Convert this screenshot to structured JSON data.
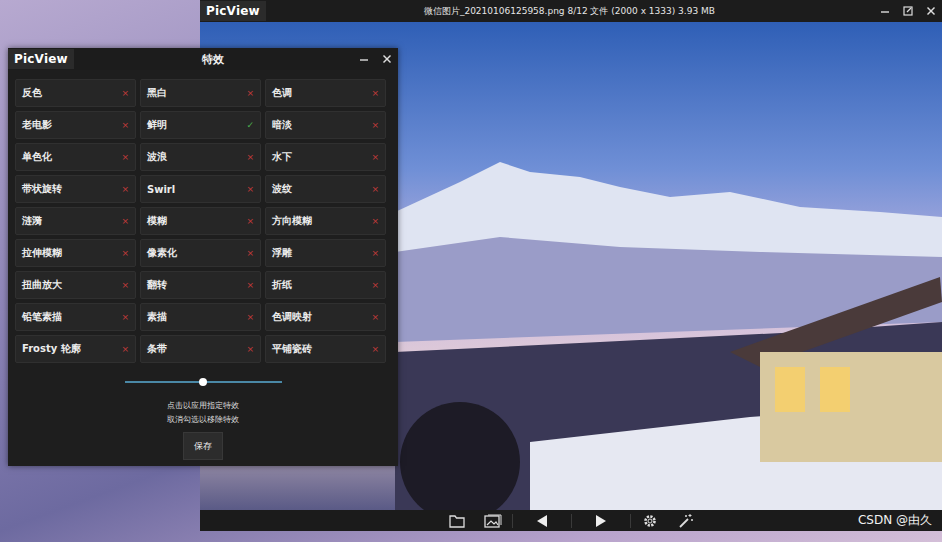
{
  "main_window": {
    "logo": "PicView",
    "title": "微信图片_20210106125958.png 8/12 文件 (2000 x 1333) 3.93 MB",
    "watermark": "CSDN @由久"
  },
  "effects_window": {
    "logo": "PicView",
    "title": "特效"
  },
  "effects": [
    {
      "label": "反色",
      "applied": false,
      "mark": "×"
    },
    {
      "label": "黑白",
      "applied": false,
      "mark": "×"
    },
    {
      "label": "色调",
      "applied": false,
      "mark": "×"
    },
    {
      "label": "老电影",
      "applied": false,
      "mark": "×"
    },
    {
      "label": "鲜明",
      "applied": true,
      "mark": "✓"
    },
    {
      "label": "暗淡",
      "applied": false,
      "mark": "×"
    },
    {
      "label": "单色化",
      "applied": false,
      "mark": "×"
    },
    {
      "label": "波浪",
      "applied": false,
      "mark": "×"
    },
    {
      "label": "水下",
      "applied": false,
      "mark": "×"
    },
    {
      "label": "带状旋转",
      "applied": false,
      "mark": "×"
    },
    {
      "label": "Swirl",
      "applied": false,
      "mark": "×"
    },
    {
      "label": "波纹",
      "applied": false,
      "mark": "×"
    },
    {
      "label": "涟漪",
      "applied": false,
      "mark": "×"
    },
    {
      "label": "模糊",
      "applied": false,
      "mark": "×"
    },
    {
      "label": "方向模糊",
      "applied": false,
      "mark": "×"
    },
    {
      "label": "拉伸模糊",
      "applied": false,
      "mark": "×"
    },
    {
      "label": "像素化",
      "applied": false,
      "mark": "×"
    },
    {
      "label": "浮雕",
      "applied": false,
      "mark": "×"
    },
    {
      "label": "扭曲放大",
      "applied": false,
      "mark": "×"
    },
    {
      "label": "翻转",
      "applied": false,
      "mark": "×"
    },
    {
      "label": "折纸",
      "applied": false,
      "mark": "×"
    },
    {
      "label": "铅笔素描",
      "applied": false,
      "mark": "×"
    },
    {
      "label": "素描",
      "applied": false,
      "mark": "×"
    },
    {
      "label": "色调映射",
      "applied": false,
      "mark": "×"
    },
    {
      "label": "Frosty 轮廓",
      "applied": false,
      "mark": "×"
    },
    {
      "label": "条带",
      "applied": false,
      "mark": "×"
    },
    {
      "label": "平铺瓷砖",
      "applied": false,
      "mark": "×"
    }
  ],
  "slider": {
    "level": 0.5
  },
  "hints": [
    "点击以应用指定特效",
    "取消勾选以移除特效"
  ],
  "buttons": [
    "保存"
  ]
}
